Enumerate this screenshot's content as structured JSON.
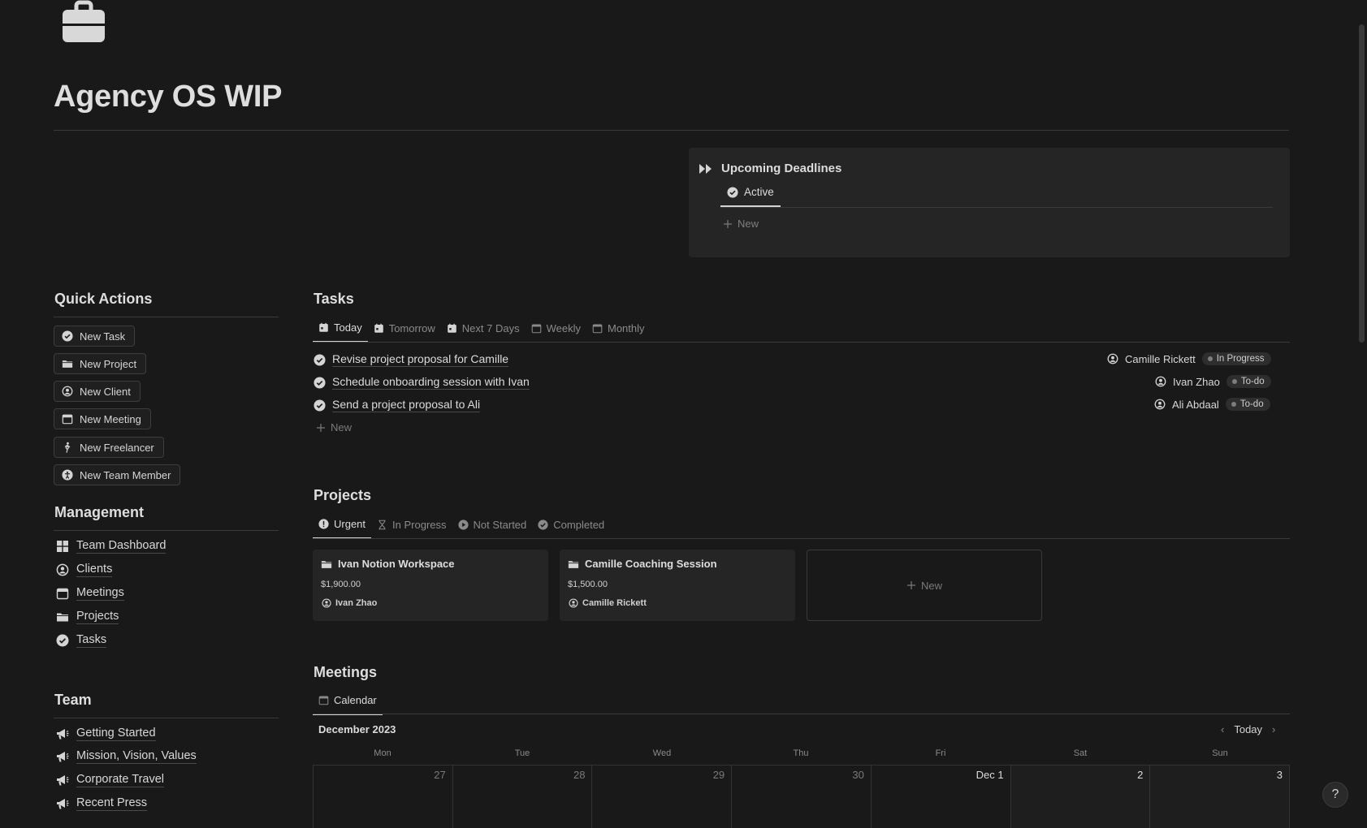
{
  "page": {
    "title": "Agency OS WIP",
    "icon": "briefcase-icon"
  },
  "upcoming": {
    "title": "Upcoming Deadlines",
    "tab": "Active",
    "new_label": "New"
  },
  "quick_actions": {
    "heading": "Quick Actions",
    "buttons": [
      {
        "label": "New Task",
        "icon": "check-circle-icon"
      },
      {
        "label": "New Project",
        "icon": "folder-icon"
      },
      {
        "label": "New Client",
        "icon": "user-circle-icon"
      },
      {
        "label": "New Meeting",
        "icon": "calendar-icon"
      },
      {
        "label": "New Freelancer",
        "icon": "walking-person-icon"
      },
      {
        "label": "New Team Member",
        "icon": "accessibility-icon"
      }
    ]
  },
  "management": {
    "heading": "Management",
    "links": [
      {
        "label": "Team Dashboard",
        "icon": "grid-icon"
      },
      {
        "label": "Clients",
        "icon": "user-circle-icon"
      },
      {
        "label": "Meetings",
        "icon": "calendar-icon"
      },
      {
        "label": "Projects",
        "icon": "folder-icon"
      },
      {
        "label": "Tasks",
        "icon": "check-circle-icon"
      }
    ]
  },
  "team": {
    "heading": "Team",
    "links": [
      {
        "label": "Getting Started",
        "icon": "megaphone-icon"
      },
      {
        "label": "Mission, Vision, Values",
        "icon": "megaphone-icon"
      },
      {
        "label": "Corporate Travel",
        "icon": "megaphone-icon"
      },
      {
        "label": "Recent Press",
        "icon": "megaphone-icon"
      }
    ]
  },
  "tasks": {
    "heading": "Tasks",
    "tabs": [
      "Today",
      "Tomorrow",
      "Next 7 Days",
      "Weekly",
      "Monthly"
    ],
    "active_tab": "Today",
    "rows": [
      {
        "title": "Revise project proposal for Camille",
        "assignee": "Camille Rickett",
        "status": "In Progress"
      },
      {
        "title": "Schedule onboarding session with Ivan",
        "assignee": "Ivan Zhao",
        "status": "To-do"
      },
      {
        "title": "Send a project proposal to Ali",
        "assignee": "Ali Abdaal",
        "status": "To-do"
      }
    ],
    "new_label": "New"
  },
  "projects": {
    "heading": "Projects",
    "tabs": [
      "Urgent",
      "In Progress",
      "Not Started",
      "Completed"
    ],
    "active_tab": "Urgent",
    "cards": [
      {
        "title": "Ivan Notion Workspace",
        "price": "$1,900.00",
        "owner": "Ivan Zhao"
      },
      {
        "title": "Camille Coaching Session",
        "price": "$1,500.00",
        "owner": "Camille Rickett"
      }
    ],
    "new_label": "New"
  },
  "meetings": {
    "heading": "Meetings",
    "tab": "Calendar",
    "month": "December 2023",
    "today_label": "Today",
    "days": [
      "Mon",
      "Tue",
      "Wed",
      "Thu",
      "Fri",
      "Sat",
      "Sun"
    ],
    "dates": [
      "27",
      "28",
      "29",
      "30",
      "Dec 1",
      "2",
      "3"
    ]
  },
  "help": {
    "label": "?"
  }
}
